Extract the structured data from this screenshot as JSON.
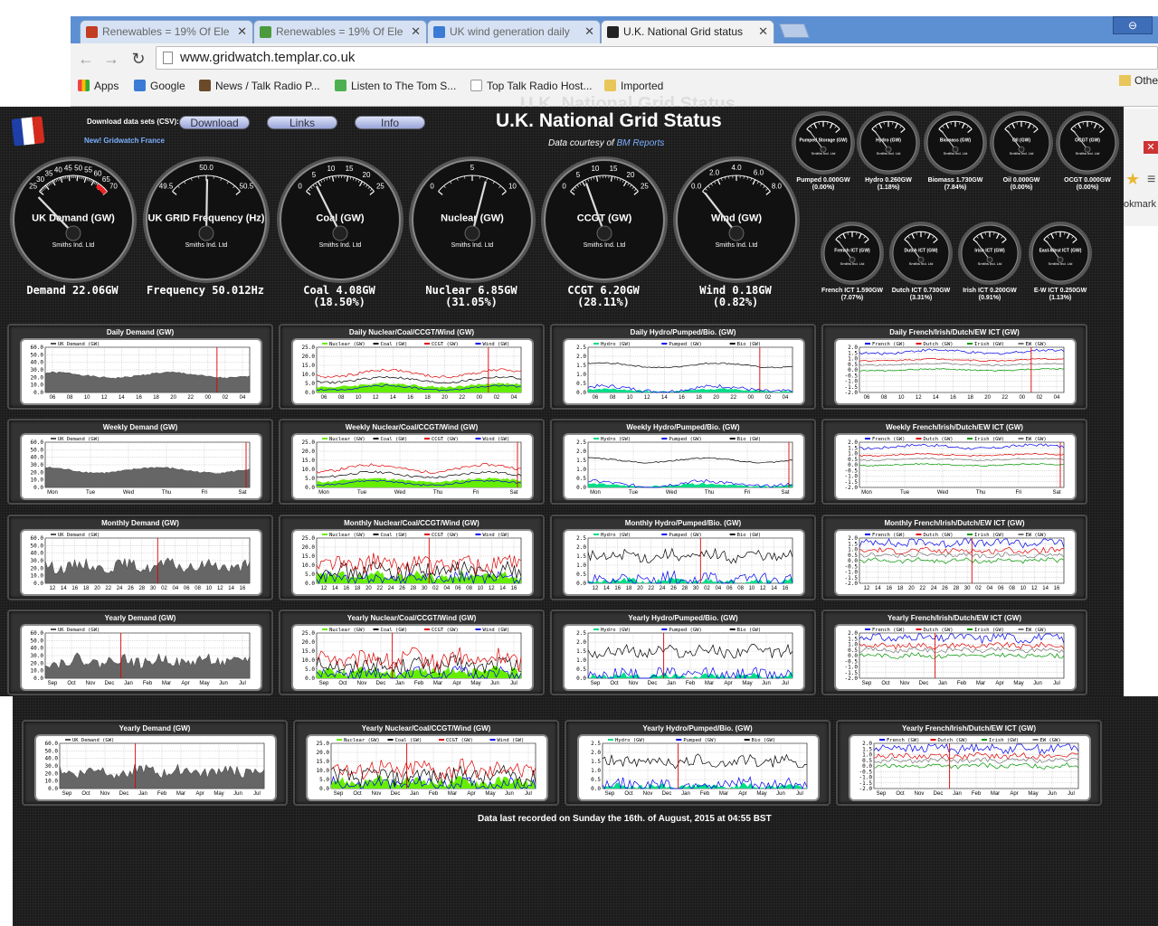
{
  "browser": {
    "tabs": [
      {
        "title": "Renewables = 19% Of Ele",
        "favicon_color": "#c23b22"
      },
      {
        "title": "Renewables = 19% Of Ele",
        "favicon_color": "#4c9a3c"
      },
      {
        "title": "UK wind generation daily",
        "favicon_color": "#3a7bd5"
      },
      {
        "title": "U.K. National Grid status",
        "favicon_color": "#222222"
      }
    ],
    "url": "www.gridwatch.templar.co.uk",
    "bookmarks": [
      "Apps",
      "Google",
      "News / Talk Radio P...",
      "Listen to The Tom S...",
      "Top Talk Radio Host...",
      "Imported"
    ],
    "other_bookmarks": "Othe",
    "side_fragment": "okmark"
  },
  "page": {
    "download_label": "Download data sets (CSV):",
    "nav": [
      "Download",
      "Links",
      "Info"
    ],
    "france_link": "New! Gridwatch France",
    "title": "U.K. National Grid Status",
    "courtesy": "Data courtesy of",
    "courtesy_link": "BM Reports",
    "maker": "Smiths Ind. Ltd",
    "last_recorded": "Data last recorded on Sunday the 16th. of August, 2015 at 04:55 BST"
  },
  "big_gauges": [
    {
      "name": "UK Demand (GW)",
      "ticks": [
        "25",
        "30",
        "35",
        "40",
        "45",
        "50",
        "55",
        "60",
        "65",
        "70"
      ],
      "min": 25,
      "max": 70,
      "value": 22.06,
      "caption1": "Demand 22.06GW",
      "caption2": ""
    },
    {
      "name": "UK GRID Frequency (Hz)",
      "ticks": [
        "49.5",
        "50.0",
        "50.5"
      ],
      "min": 49.5,
      "max": 50.5,
      "value": 50.012,
      "caption1": "Frequency 50.012Hz",
      "caption2": ""
    },
    {
      "name": "Coal (GW)",
      "ticks": [
        "0",
        "5",
        "10",
        "15",
        "20",
        "25"
      ],
      "min": 0,
      "max": 25,
      "value": 4.08,
      "caption1": "Coal 4.08GW",
      "caption2": "(18.50%)"
    },
    {
      "name": "Nuclear (GW)",
      "ticks": [
        "0",
        "5",
        "10"
      ],
      "min": 0,
      "max": 10,
      "value": 6.85,
      "caption1": "Nuclear 6.85GW",
      "caption2": "(31.05%)"
    },
    {
      "name": "CCGT (GW)",
      "ticks": [
        "0",
        "5",
        "10",
        "15",
        "20",
        "25"
      ],
      "min": 0,
      "max": 25,
      "value": 6.2,
      "caption1": "CCGT 6.20GW",
      "caption2": "(28.11%)"
    },
    {
      "name": "Wind (GW)",
      "ticks": [
        "0.0",
        "2.0",
        "4.0",
        "6.0",
        "8.0"
      ],
      "min": 0,
      "max": 8,
      "value": 0.18,
      "caption1": "Wind 0.18GW",
      "caption2": "(0.82%)"
    }
  ],
  "small_gauges": [
    {
      "name": "Pumped Storage (GW)",
      "caption1": "Pumped 0.000GW",
      "caption2": "(0.00%)"
    },
    {
      "name": "Hydro (GW)",
      "caption1": "Hydro 0.260GW",
      "caption2": "(1.18%)"
    },
    {
      "name": "Biomass (GW)",
      "caption1": "Biomass 1.730GW",
      "caption2": "(7.84%)"
    },
    {
      "name": "Oil (GW)",
      "caption1": "Oil 0.000GW",
      "caption2": "(0.00%)"
    },
    {
      "name": "OCGT (GW)",
      "caption1": "OCGT 0.000GW",
      "caption2": "(0.00%)"
    },
    {
      "name": "French ICT (GW)",
      "caption1": "French ICT 1.590GW",
      "caption2": "(7.07%)"
    },
    {
      "name": "Dutch ICT (GW)",
      "caption1": "Dutch ICT 0.730GW",
      "caption2": "(3.31%)"
    },
    {
      "name": "Irish ICT (GW)",
      "caption1": "Irish ICT 0.200GW",
      "caption2": "(0.91%)"
    },
    {
      "name": "East-West ICT (GW)",
      "caption1": "E-W ICT 0.250GW",
      "caption2": "(1.13%)"
    }
  ],
  "panel_rows": [
    {
      "period": "Daily",
      "xticks": [
        "06",
        "08",
        "10",
        "12",
        "14",
        "16",
        "18",
        "20",
        "22",
        "00",
        "02",
        "04"
      ]
    },
    {
      "period": "Weekly",
      "xticks": [
        "Mon",
        "Tue",
        "Wed",
        "Thu",
        "Fri",
        "Sat"
      ]
    },
    {
      "period": "Monthly",
      "xticks": [
        "12",
        "14",
        "16",
        "18",
        "20",
        "22",
        "24",
        "26",
        "28",
        "30",
        "02",
        "04",
        "06",
        "08",
        "10",
        "12",
        "14",
        "16"
      ]
    },
    {
      "period": "Yearly",
      "xticks": [
        "Sep",
        "Oct",
        "Nov",
        "Dec",
        "Jan",
        "Feb",
        "Mar",
        "Apr",
        "May",
        "Jun",
        "Jul"
      ]
    }
  ],
  "panel_types": [
    {
      "suffix": "Demand (GW)",
      "legend": [
        "UK Demand (GW)"
      ],
      "colors": [
        "#555555"
      ],
      "yticks": [
        "60.0",
        "50.0",
        "40.0",
        "30.0",
        "20.0",
        "10.0",
        "0.0"
      ]
    },
    {
      "suffix": "Nuclear/Coal/CCGT/Wind (GW)",
      "legend": [
        "Nuclear (GW)",
        "Coal (GW)",
        "CCGT (GW)",
        "Wind (GW)"
      ],
      "colors": [
        "#66ee00",
        "#000000",
        "#dd0000",
        "#0000ee"
      ],
      "yticks": [
        "25.0",
        "20.0",
        "15.0",
        "10.0",
        "5.0",
        "0.0"
      ]
    },
    {
      "suffix": "Hydro/Pumped/Bio. (GW)",
      "legend": [
        "Hydro (GW)",
        "Pumped (GW)",
        "Bio (GW)"
      ],
      "colors": [
        "#00dd88",
        "#0000ee",
        "#000000"
      ],
      "yticks": [
        "2.5",
        "2.0",
        "1.5",
        "1.0",
        "0.5",
        "0.0"
      ]
    },
    {
      "suffix": "French/Irish/Dutch/EW ICT (GW)",
      "legend": [
        "French (GW)",
        "Dutch (GW)",
        "Irish (GW)",
        "EW (GW)"
      ],
      "colors": [
        "#0000ee",
        "#dd0000",
        "#009900",
        "#777777"
      ],
      "yticks": [
        "2.0",
        "1.5",
        "1.0",
        "0.5",
        "0.0",
        "-0.5",
        "-1.0",
        "-1.5",
        "-2.0"
      ]
    }
  ],
  "colors": {
    "page_bg": "#1b1b1b",
    "link": "#7ab1ff",
    "gauge_face": "#111111"
  }
}
